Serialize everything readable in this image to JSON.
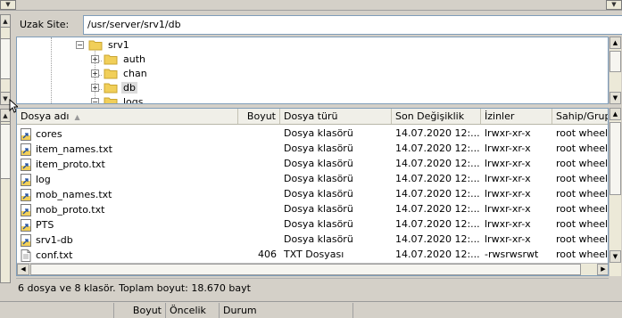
{
  "remote_site": {
    "label": "Uzak Site:",
    "path": "/usr/server/srv1/db"
  },
  "tree": [
    {
      "label": "srv1",
      "expander": "−",
      "selected": false
    },
    {
      "label": "auth",
      "expander": "+",
      "selected": false
    },
    {
      "label": "chan",
      "expander": "+",
      "selected": false
    },
    {
      "label": "db",
      "expander": "+",
      "selected": true
    },
    {
      "label": "logs",
      "expander": "−",
      "selected": false
    }
  ],
  "columns": {
    "name": "Dosya adı",
    "size": "Boyut",
    "type": "Dosya türü",
    "modified": "Son Değişiklik",
    "perms": "İzinler",
    "owner": "Sahip/Grup"
  },
  "files": [
    {
      "name": "cores",
      "size": "",
      "type": "Dosya klasörü",
      "modified": "14.07.2020 12:...",
      "perms": "lrwxr-xr-x",
      "owner": "root wheel",
      "icon": "folder-link-icon"
    },
    {
      "name": "item_names.txt",
      "size": "",
      "type": "Dosya klasörü",
      "modified": "14.07.2020 12:...",
      "perms": "lrwxr-xr-x",
      "owner": "root wheel",
      "icon": "folder-link-icon"
    },
    {
      "name": "item_proto.txt",
      "size": "",
      "type": "Dosya klasörü",
      "modified": "14.07.2020 12:...",
      "perms": "lrwxr-xr-x",
      "owner": "root wheel",
      "icon": "folder-link-icon"
    },
    {
      "name": "log",
      "size": "",
      "type": "Dosya klasörü",
      "modified": "14.07.2020 12:...",
      "perms": "lrwxr-xr-x",
      "owner": "root wheel",
      "icon": "folder-link-icon"
    },
    {
      "name": "mob_names.txt",
      "size": "",
      "type": "Dosya klasörü",
      "modified": "14.07.2020 12:...",
      "perms": "lrwxr-xr-x",
      "owner": "root wheel",
      "icon": "folder-link-icon"
    },
    {
      "name": "mob_proto.txt",
      "size": "",
      "type": "Dosya klasörü",
      "modified": "14.07.2020 12:...",
      "perms": "lrwxr-xr-x",
      "owner": "root wheel",
      "icon": "folder-link-icon"
    },
    {
      "name": "PTS",
      "size": "",
      "type": "Dosya klasörü",
      "modified": "14.07.2020 12:...",
      "perms": "lrwxr-xr-x",
      "owner": "root wheel",
      "icon": "folder-link-icon"
    },
    {
      "name": "srv1-db",
      "size": "",
      "type": "Dosya klasörü",
      "modified": "14.07.2020 12:...",
      "perms": "lrwxr-xr-x",
      "owner": "root wheel",
      "icon": "folder-link-icon"
    },
    {
      "name": "conf.txt",
      "size": "406",
      "type": "TXT Dosyası",
      "modified": "14.07.2020 12:...",
      "perms": "-rwsrwsrwt",
      "owner": "root wheel",
      "icon": "text-file-icon"
    }
  ],
  "status_text": "6 dosya ve 8 klasör. Toplam boyut: 18.670 bayt",
  "queue_columns": {
    "size": "Boyut",
    "priority": "Öncelik",
    "status": "Durum"
  },
  "colors": {
    "window_bg": "#d4d0c8",
    "border_blue": "#7f9db9",
    "folder_yellow": "#f1cf59",
    "selection_gray": "#dcdcdc"
  }
}
